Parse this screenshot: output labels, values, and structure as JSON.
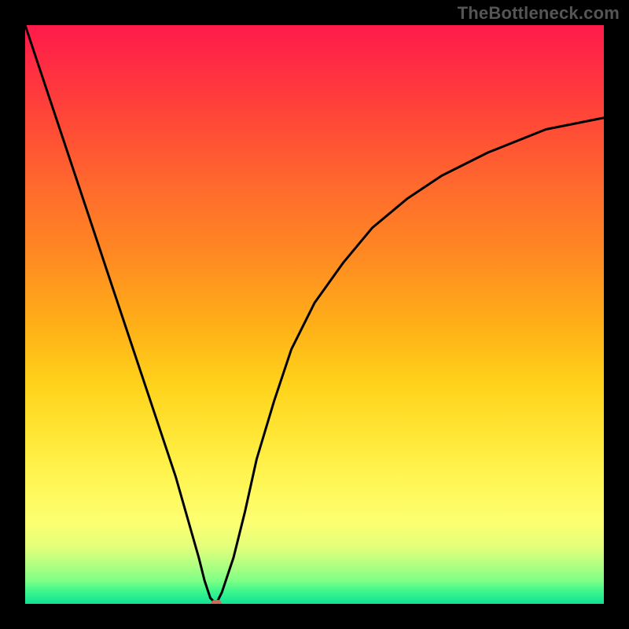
{
  "watermark": "TheBottleneck.com",
  "colors": {
    "background": "#000000",
    "curve": "#000000",
    "marker": "#cf6a5b"
  },
  "chart_data": {
    "type": "line",
    "title": "",
    "xlabel": "",
    "ylabel": "",
    "xlim": [
      0,
      100
    ],
    "ylim": [
      0,
      100
    ],
    "grid": false,
    "legend": false,
    "series": [
      {
        "name": "bottleneck-curve",
        "color": "#000000",
        "x": [
          0,
          2,
          5,
          8,
          11,
          14,
          17,
          20,
          23,
          26,
          28,
          30,
          31,
          32,
          33,
          34,
          36,
          38,
          40,
          43,
          46,
          50,
          55,
          60,
          66,
          72,
          80,
          90,
          100
        ],
        "y": [
          100,
          94,
          85,
          76,
          67,
          58,
          49,
          40,
          31,
          22,
          15,
          8,
          4,
          1,
          0,
          2,
          8,
          16,
          25,
          35,
          44,
          52,
          59,
          65,
          70,
          74,
          78,
          82,
          84
        ]
      }
    ],
    "marker": {
      "x": 33,
      "y": 0,
      "color": "#cf6a5b"
    }
  }
}
